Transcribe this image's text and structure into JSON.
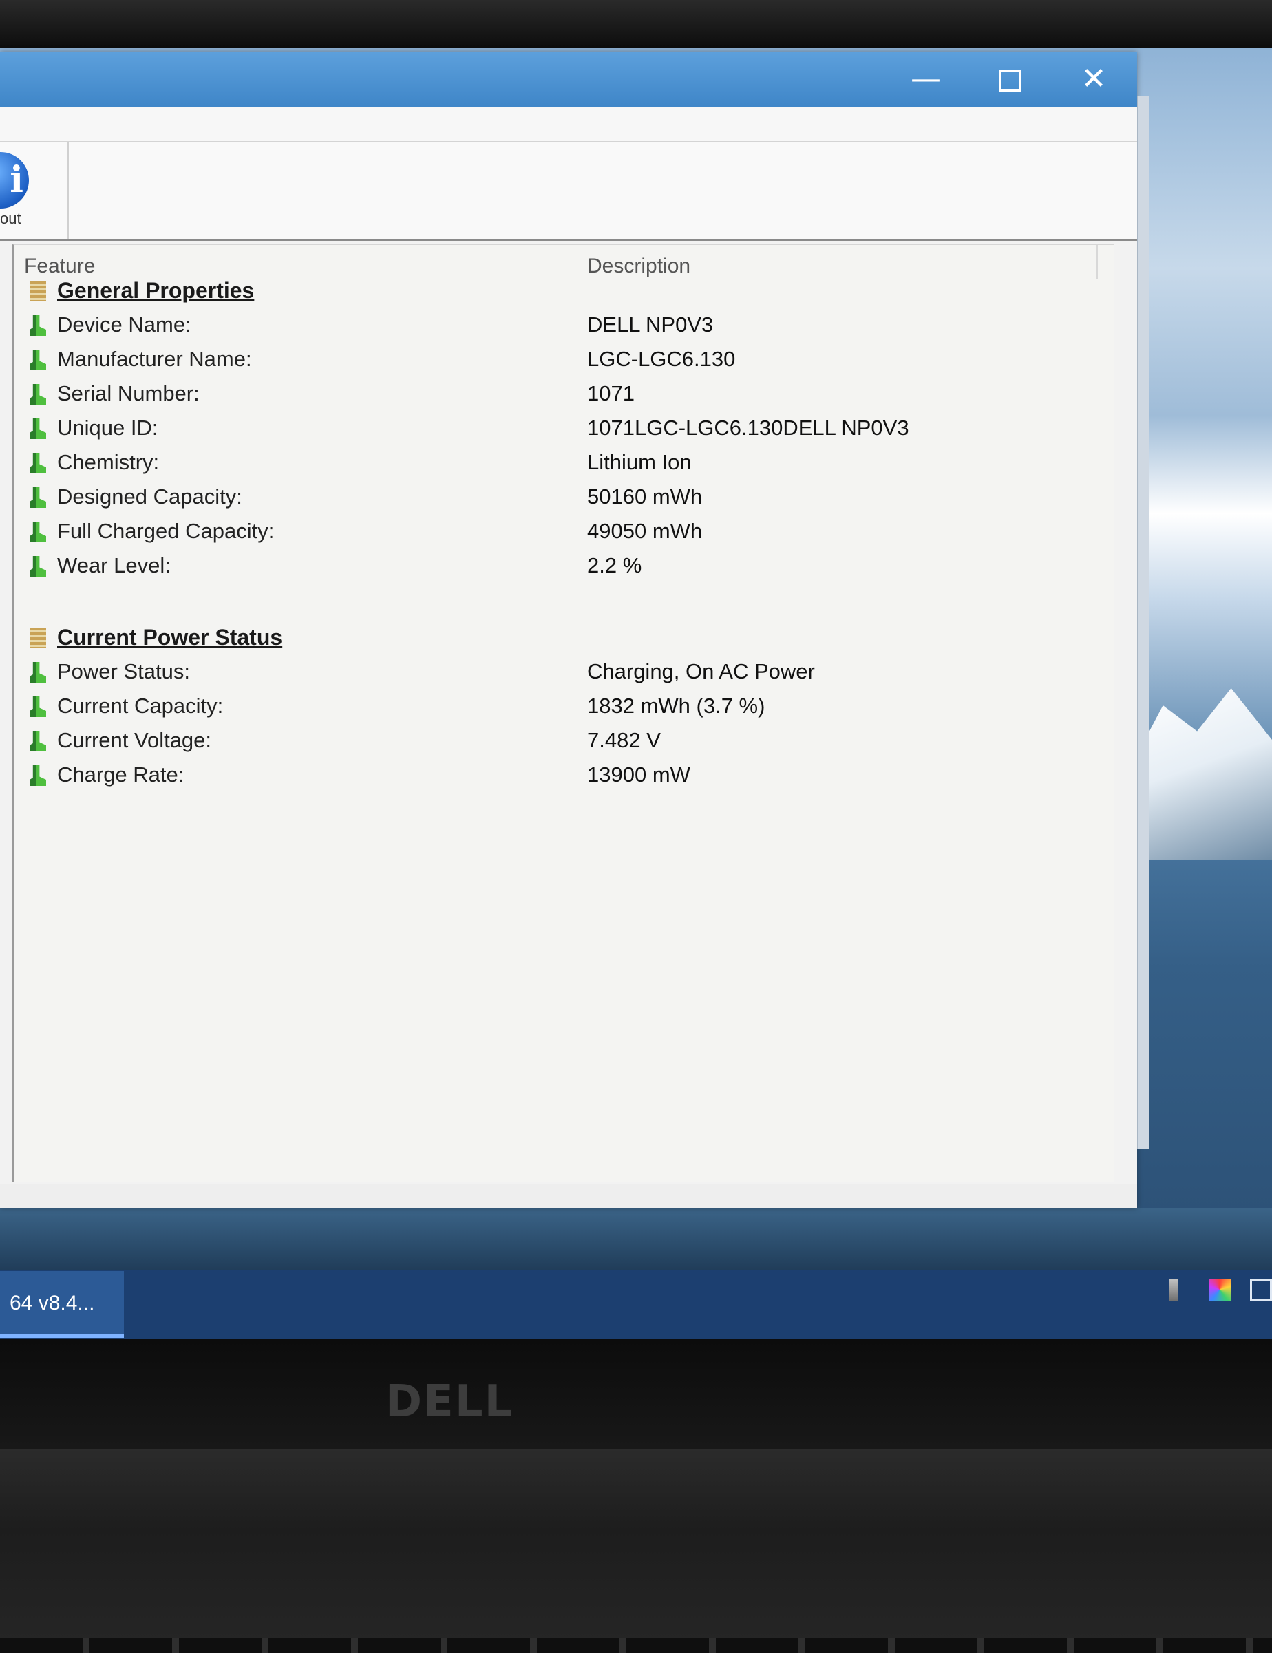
{
  "window": {
    "buttons": {
      "minimize": "—",
      "close": "✕"
    },
    "toolbar": {
      "about_label": "out",
      "about_glyph": "i"
    }
  },
  "list": {
    "columns": {
      "feature": "Feature",
      "description": "Description"
    },
    "groups": [
      {
        "title": "General Properties",
        "rows": [
          {
            "feature": "Device Name:",
            "value": "DELL NP0V3"
          },
          {
            "feature": "Manufacturer Name:",
            "value": "LGC-LGC6.130"
          },
          {
            "feature": "Serial Number:",
            "value": "1071"
          },
          {
            "feature": "Unique ID:",
            "value": "1071LGC-LGC6.130DELL NP0V3"
          },
          {
            "feature": "Chemistry:",
            "value": "Lithium Ion"
          },
          {
            "feature": "Designed Capacity:",
            "value": "50160 mWh"
          },
          {
            "feature": "Full Charged Capacity:",
            "value": "49050 mWh"
          },
          {
            "feature": "Wear Level:",
            "value": "2.2 %"
          }
        ]
      },
      {
        "title": "Current Power Status",
        "rows": [
          {
            "feature": "Power Status:",
            "value": "Charging, On AC Power"
          },
          {
            "feature": "Current Capacity:",
            "value": "1832 mWh (3.7 %)"
          },
          {
            "feature": "Current Voltage:",
            "value": "7.482 V"
          },
          {
            "feature": "Charge Rate:",
            "value": "13900 mW"
          }
        ]
      }
    ]
  },
  "taskbar": {
    "active_item": "64 v8.4..."
  },
  "bezel": {
    "logo": "DELL"
  },
  "icons": {
    "group": "folder-group-icon",
    "leaf": "battery-leaf-icon",
    "about": "info-icon"
  },
  "colors": {
    "titlebar": "#4a92d4",
    "taskbar": "#1c3f70",
    "leaf_icon": "#3fa83a"
  }
}
